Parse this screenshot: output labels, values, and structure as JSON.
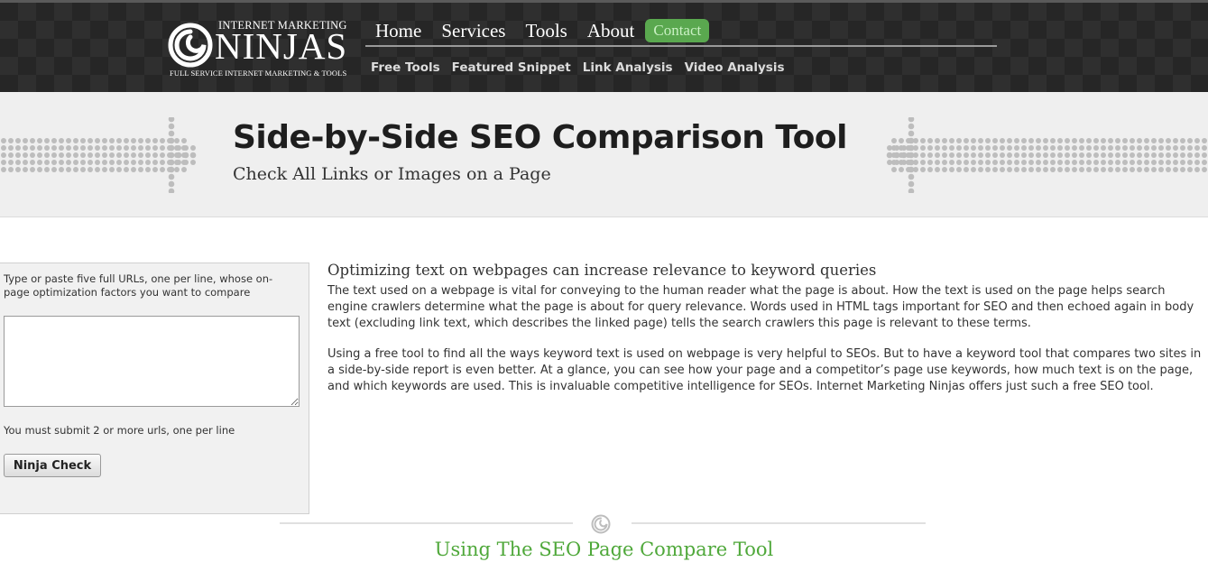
{
  "header": {
    "logo": {
      "top_text": "INTERNET MARKETING",
      "main_text": "NINJAS",
      "bottom_text": "FULL SERVICE INTERNET MARKETING & TOOLS",
      "icon": "swirl-logo-icon"
    },
    "nav": [
      {
        "label": "Home"
      },
      {
        "label": "Services"
      },
      {
        "label": "Tools"
      },
      {
        "label": "About"
      }
    ],
    "contact_label": "Contact",
    "subnav": [
      {
        "label": "Free Tools"
      },
      {
        "label": "Featured Snippet"
      },
      {
        "label": "Link Analysis"
      },
      {
        "label": "Video Analysis"
      }
    ]
  },
  "banner": {
    "title": "Side-by-Side SEO Comparison Tool",
    "subtitle": "Check All Links or Images on a Page"
  },
  "form": {
    "label": "Type or paste five full URLs, one per line, whose on-page optimization factors you want to compare",
    "textarea_value": "",
    "hint": "You must submit 2 or more urls, one per line",
    "button_label": "Ninja Check"
  },
  "content": {
    "heading": "Optimizing text on webpages can increase relevance to keyword queries",
    "paragraphs": [
      "The text used on a webpage is vital for conveying to the human reader what the page is about. How the text is used on the page helps search engine crawlers determine what the page is about for query relevance. Words used in HTML tags important for SEO and then echoed again in body text (excluding link text, which describes the linked page) tells the search crawlers this page is relevant to these terms.",
      "Using a free tool to find all the ways keyword text is used on webpage is very helpful to SEOs. But to have a keyword tool that compares two sites in a side-by-side report is even better. At a glance, you can see how your page and a competitor’s page use keywords, how much text is on the page, and which keywords are used. This is invaluable competitive intelligence for SEOs. Internet Marketing Ninjas offers just such a free SEO tool."
    ]
  },
  "section": {
    "title": "Using The SEO Page Compare Tool",
    "icon": "swirl-icon"
  },
  "colors": {
    "header_bg": "#262626",
    "contact_bg": "#5aa84f",
    "section_title": "#4fa83a",
    "banner_bg": "#efefef"
  }
}
